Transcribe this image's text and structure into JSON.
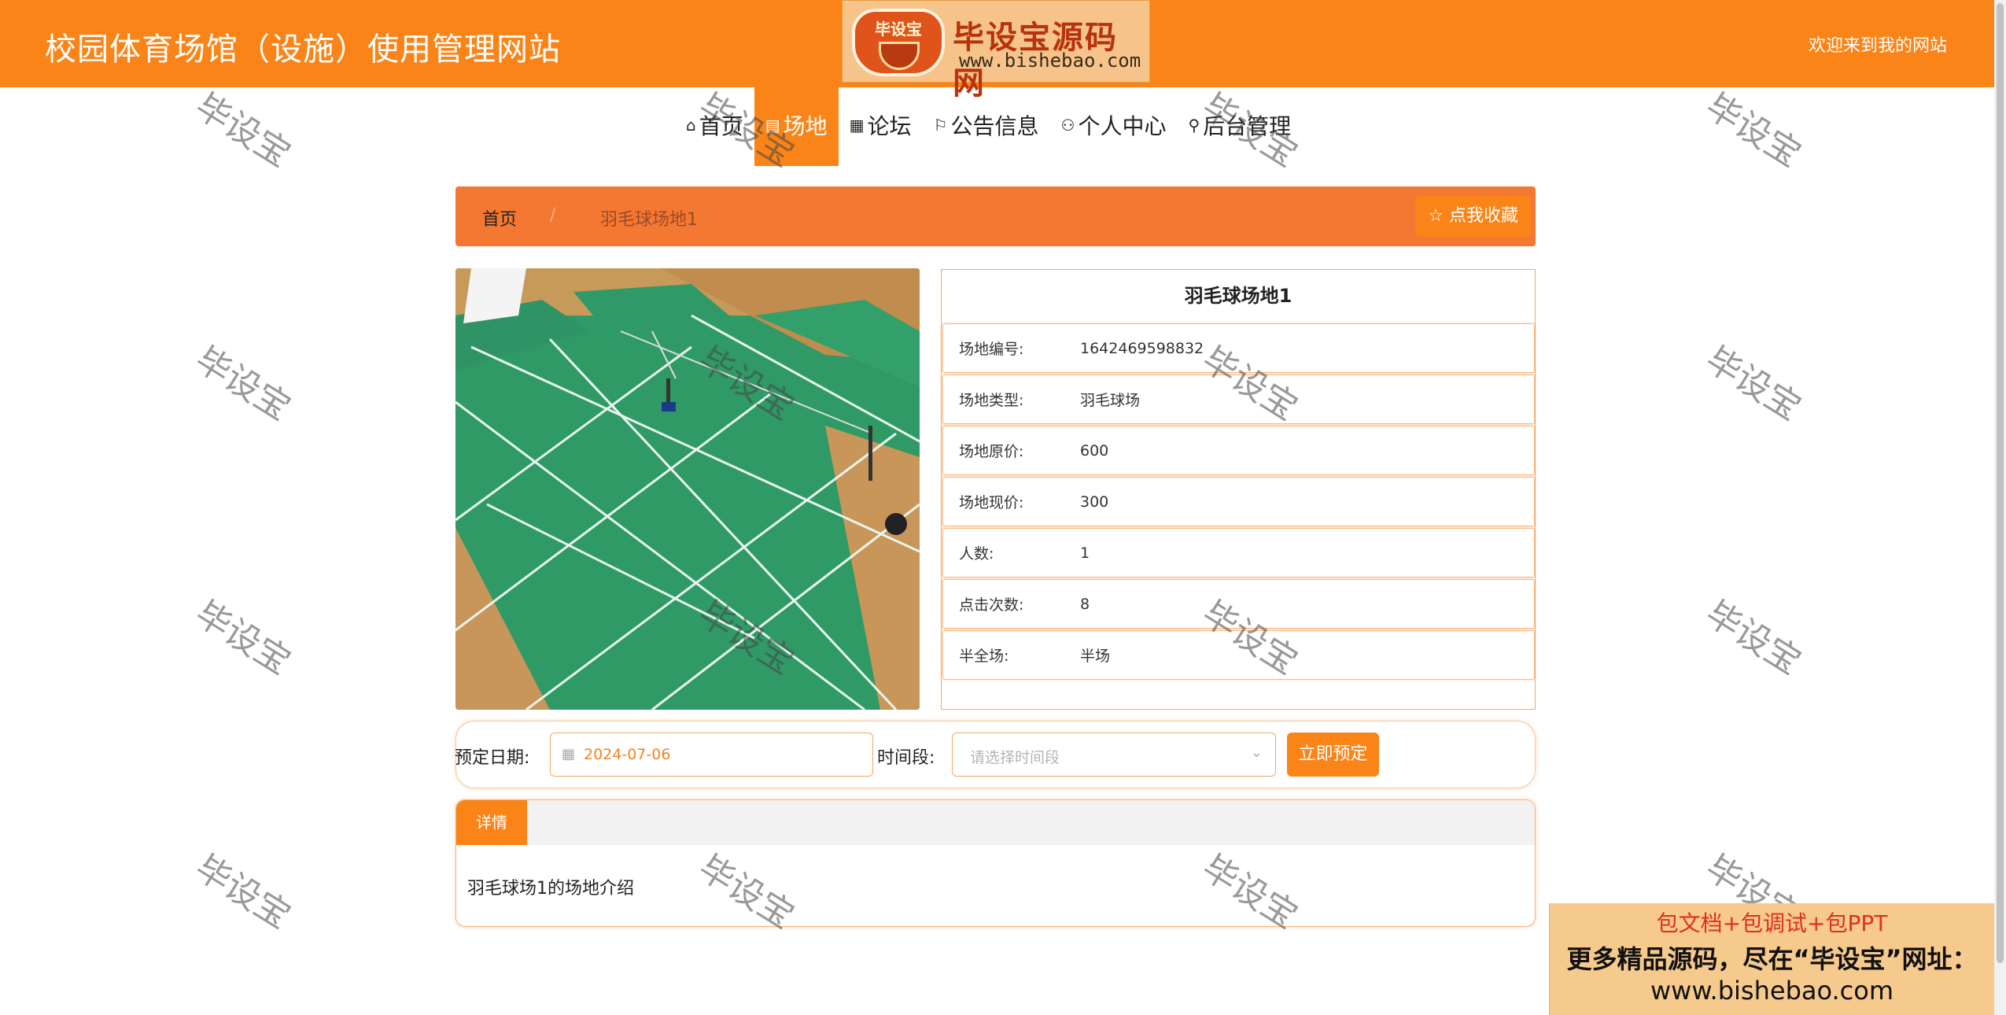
{
  "header": {
    "site_title": "校园体育场馆（设施）使用管理网站",
    "welcome": "欢迎来到我的网站",
    "brand_badge": "毕设宝",
    "brand_name": "毕设宝源码网",
    "brand_url": "www.bishebao.com",
    "color": "#fb8418"
  },
  "nav": {
    "items": [
      {
        "label": "首页",
        "icon": "home-icon"
      },
      {
        "label": "场地",
        "icon": "venue-icon",
        "active": true
      },
      {
        "label": "论坛",
        "icon": "grid-icon"
      },
      {
        "label": "公告信息",
        "icon": "flag-icon"
      },
      {
        "label": "个人中心",
        "icon": "user-icon"
      },
      {
        "label": "后台管理",
        "icon": "link-icon"
      }
    ]
  },
  "breadcrumb": {
    "home": "首页",
    "separator": "/",
    "current": "羽毛球场地1",
    "favorite_button": "点我收藏"
  },
  "venue": {
    "title": "羽毛球场地1",
    "fields": [
      {
        "label": "场地编号:",
        "value": "1642469598832"
      },
      {
        "label": "场地类型:",
        "value": "羽毛球场"
      },
      {
        "label": "场地原价:",
        "value": "600"
      },
      {
        "label": "场地现价:",
        "value": "300"
      },
      {
        "label": "人数:",
        "value": "1"
      },
      {
        "label": "点击次数:",
        "value": "8"
      },
      {
        "label": "半全场:",
        "value": "半场"
      }
    ]
  },
  "booking": {
    "date_label": "预定日期:",
    "date_value": "2024-07-06",
    "time_label": "时间段:",
    "time_placeholder": "请选择时间段",
    "submit": "立即预定"
  },
  "tabs": {
    "active": "详情",
    "content": "羽毛球场1的场地介绍"
  },
  "watermark": "毕设宝",
  "ad": {
    "line1": "包文档+包调试+包PPT",
    "line2": "更多精品源码，尽在“毕设宝”网址：",
    "line3": "www.bishebao.com"
  }
}
